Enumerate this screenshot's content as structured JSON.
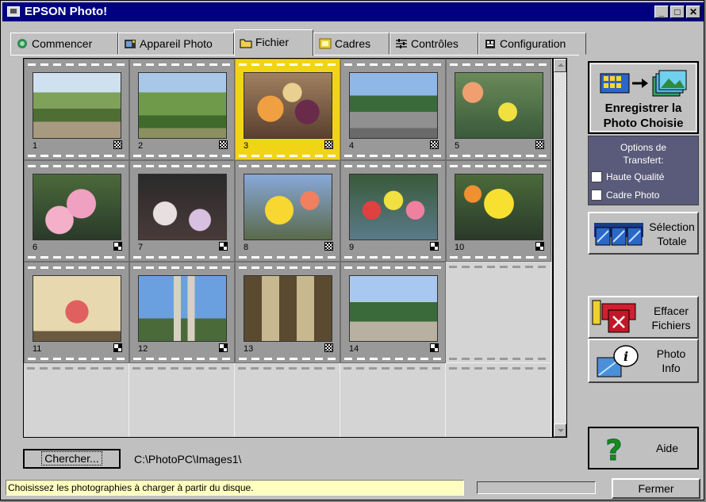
{
  "window": {
    "title": "EPSON Photo!"
  },
  "tabs": [
    {
      "label": "Commencer",
      "icon": "camera-start-icon"
    },
    {
      "label": "Appareil Photo",
      "icon": "camera-icon"
    },
    {
      "label": "Fichier",
      "icon": "folder-icon",
      "active": true
    },
    {
      "label": "Cadres",
      "icon": "frame-icon"
    },
    {
      "label": "Contrôles",
      "icon": "sliders-icon"
    },
    {
      "label": "Configuration",
      "icon": "settings-icon"
    }
  ],
  "photos": [
    {
      "num": "1",
      "scene": "park-path"
    },
    {
      "num": "2",
      "scene": "trees-park"
    },
    {
      "num": "3",
      "scene": "fruit-market",
      "selected": true
    },
    {
      "num": "4",
      "scene": "street-trees"
    },
    {
      "num": "5",
      "scene": "flower-stand"
    },
    {
      "num": "6",
      "scene": "pink-hydrangeas"
    },
    {
      "num": "7",
      "scene": "flower-market-dark"
    },
    {
      "num": "8",
      "scene": "yellow-flowers"
    },
    {
      "num": "9",
      "scene": "flower-buckets"
    },
    {
      "num": "10",
      "scene": "yellow-bouquets"
    },
    {
      "num": "11",
      "scene": "flower-painting"
    },
    {
      "num": "12",
      "scene": "cathedral"
    },
    {
      "num": "13",
      "scene": "arches"
    },
    {
      "num": "14",
      "scene": "plaza-trees"
    }
  ],
  "save_button": {
    "label_line1": "Enregistrer la",
    "label_line2": "Photo Choisie"
  },
  "transfer_options": {
    "title_line1": "Options de",
    "title_line2": "Transfert:",
    "high_quality": "Haute Qualité",
    "photo_frame": "Cadre Photo"
  },
  "select_all": {
    "line1": "Sélection",
    "line2": "Totale"
  },
  "delete_files": {
    "line1": "Effacer",
    "line2": "Fichiers"
  },
  "photo_info": {
    "line1": "Photo",
    "line2": "Info"
  },
  "help": {
    "label": "Aide"
  },
  "browse": {
    "label": "Chercher...",
    "path": "C:\\PhotoPC\\Images1\\"
  },
  "status": {
    "text": "Choisissez les photographies à charger à partir du disque."
  },
  "close": {
    "label": "Fermer"
  },
  "colors": {
    "titlebar": "#000080",
    "selection": "#f2d416",
    "status_bg": "#ffffc0",
    "options_bg": "#5a5a7a"
  }
}
